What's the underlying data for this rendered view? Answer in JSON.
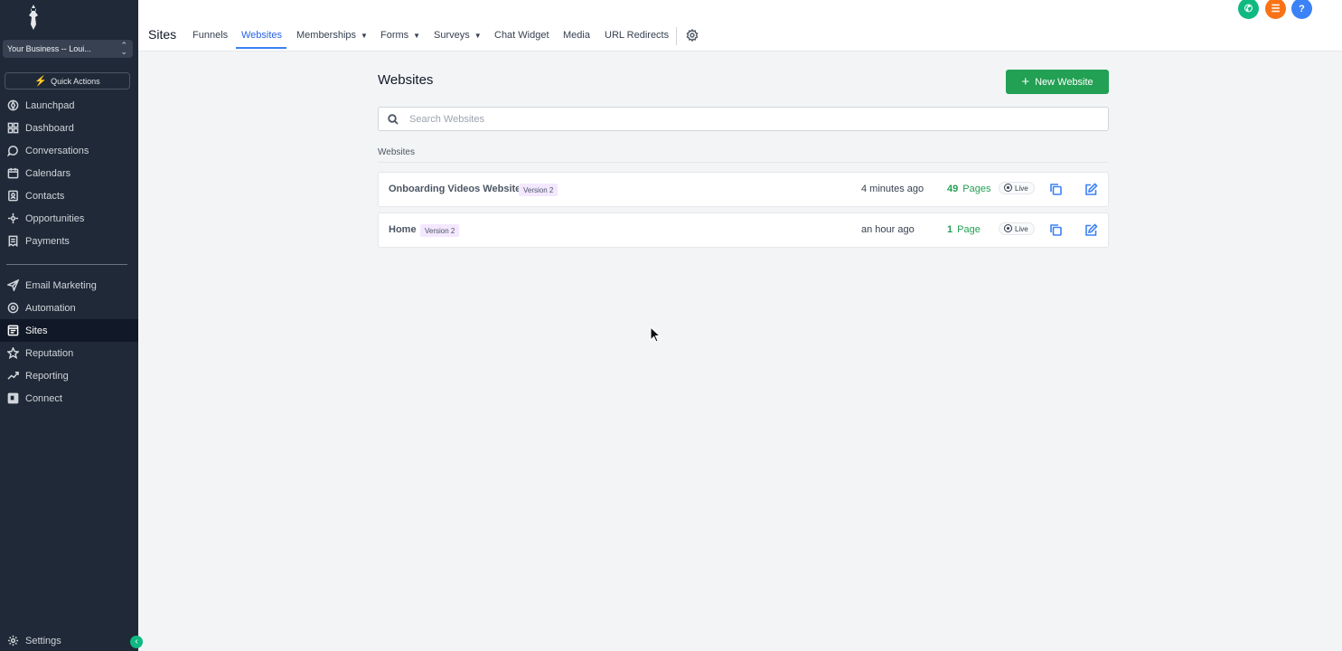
{
  "sidebar": {
    "business_switcher": "Your Business -- Loui...",
    "quick_actions": "Quick Actions",
    "items": [
      {
        "label": "Launchpad",
        "icon": "rocket-icon"
      },
      {
        "label": "Dashboard",
        "icon": "dashboard-icon"
      },
      {
        "label": "Conversations",
        "icon": "chat-icon"
      },
      {
        "label": "Calendars",
        "icon": "calendar-icon"
      },
      {
        "label": "Contacts",
        "icon": "contacts-icon"
      },
      {
        "label": "Opportunities",
        "icon": "funnel-icon"
      },
      {
        "label": "Payments",
        "icon": "payments-icon"
      },
      {
        "label": "Email Marketing",
        "icon": "send-icon"
      },
      {
        "label": "Automation",
        "icon": "automation-icon"
      },
      {
        "label": "Sites",
        "icon": "sites-icon",
        "active": true
      },
      {
        "label": "Reputation",
        "icon": "star-icon"
      },
      {
        "label": "Reporting",
        "icon": "trend-icon"
      },
      {
        "label": "Connect",
        "icon": "connect-icon"
      }
    ],
    "settings": "Settings"
  },
  "header": {
    "section_title": "Sites",
    "tabs": [
      {
        "label": "Funnels"
      },
      {
        "label": "Websites",
        "active": true
      },
      {
        "label": "Memberships",
        "dropdown": true
      },
      {
        "label": "Forms",
        "dropdown": true
      },
      {
        "label": "Surveys",
        "dropdown": true
      },
      {
        "label": "Chat Widget"
      },
      {
        "label": "Media"
      },
      {
        "label": "URL Redirects"
      }
    ],
    "round_buttons": [
      {
        "icon": "phone-icon",
        "color": "#10b981"
      },
      {
        "icon": "list-icon",
        "color": "#f97316"
      },
      {
        "icon": "help-icon",
        "color": "#3b82f6"
      }
    ]
  },
  "main": {
    "title": "Websites",
    "new_button": "New Website",
    "search_placeholder": "Search Websites",
    "list_label": "Websites",
    "sites": [
      {
        "name": "Onboarding Videos Website",
        "version": "Version 2",
        "updated": "4 minutes ago",
        "page_count": "49",
        "page_unit": "Pages",
        "status": "Live"
      },
      {
        "name": "Home",
        "version": "Version 2",
        "updated": "an hour ago",
        "page_count": "1",
        "page_unit": "Page",
        "status": "Live"
      }
    ]
  },
  "colors": {
    "sidebar_bg": "#1f2937",
    "accent_green": "#22a053",
    "link_blue": "#2563eb",
    "version_badge_bg": "#f3e8ff"
  }
}
